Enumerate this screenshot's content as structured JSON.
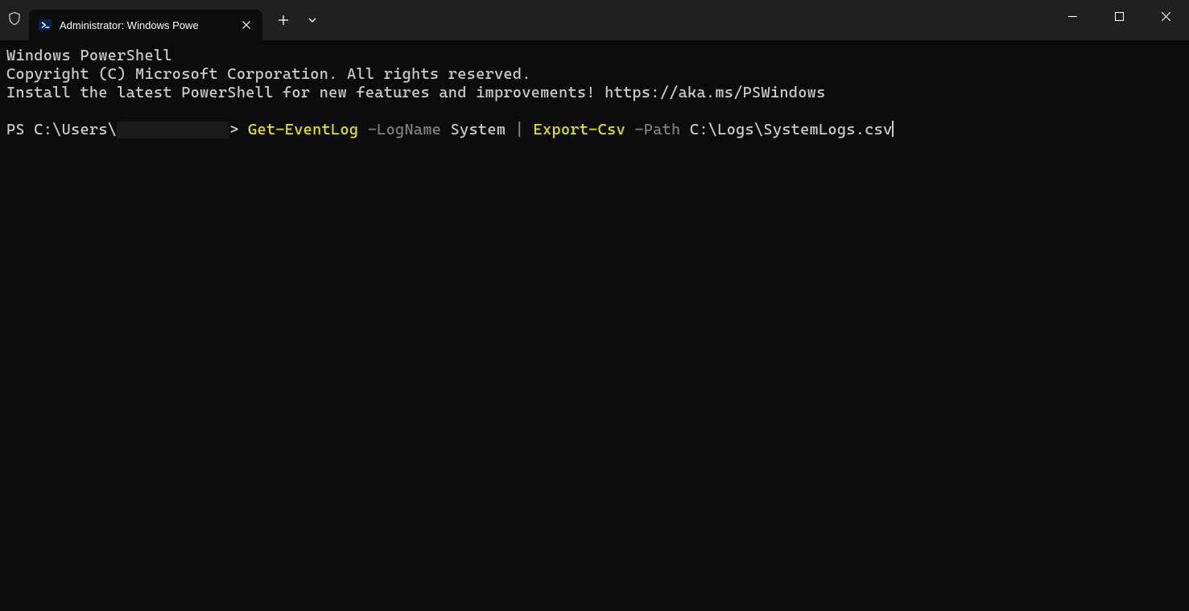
{
  "titlebar": {
    "tab_title": "Administrator: Windows Powe"
  },
  "terminal": {
    "line1": "Windows PowerShell",
    "line2": "Copyright (C) Microsoft Corporation. All rights reserved.",
    "line3": "",
    "line4": "Install the latest PowerShell for new features and improvements! https://aka.ms/PSWindows",
    "prompt_prefix": "PS C:\\Users\\",
    "prompt_suffix": ">",
    "cmd": {
      "cmdlet1": "Get-EventLog",
      "param1": "-LogName",
      "arg1": "System",
      "pipe": "|",
      "cmdlet2": "Export-Csv",
      "param2": "-Path",
      "arg2": "C:\\Logs\\SystemLogs.csv"
    }
  },
  "colors": {
    "titlebar_bg": "#202020",
    "terminal_bg": "#0c0c0c",
    "text": "#cccccc",
    "cmdlet": "#e5e510",
    "param": "#808080"
  }
}
